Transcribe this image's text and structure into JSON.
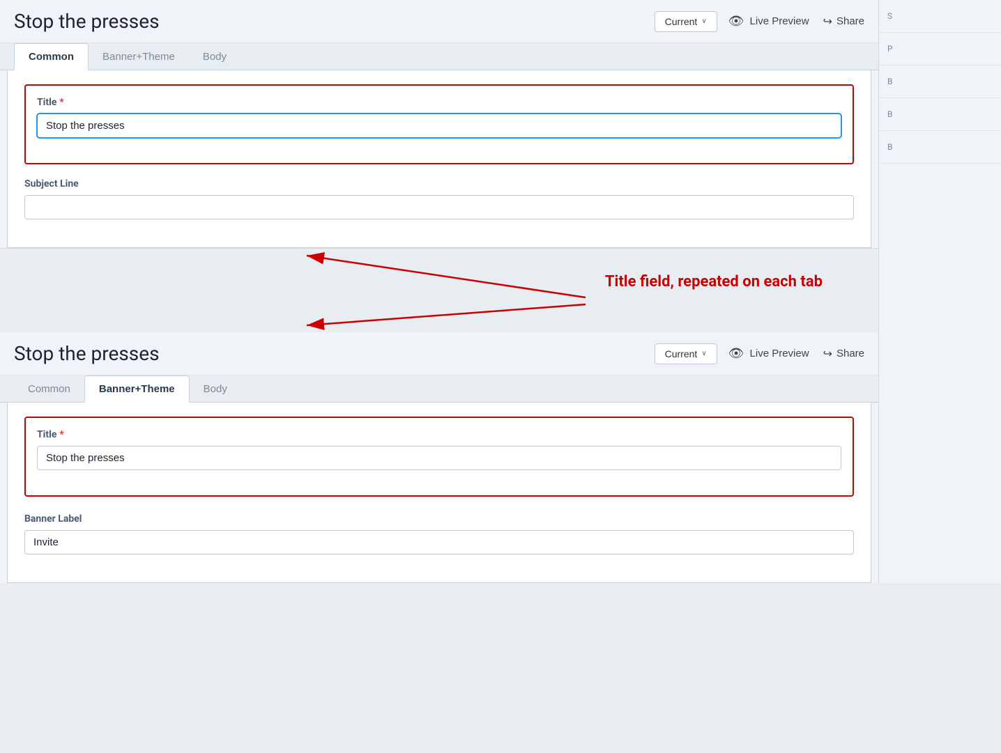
{
  "topSection": {
    "title": "Stop the presses",
    "currentBtn": "Current",
    "chevron": "∨",
    "livePreview": "Live Preview",
    "share": "Share",
    "tabs": [
      {
        "label": "Common",
        "active": true
      },
      {
        "label": "Banner+Theme",
        "active": false
      },
      {
        "label": "Body",
        "active": false
      }
    ],
    "titleField": {
      "label": "Title",
      "required": true,
      "value": "Stop the presses",
      "placeholder": ""
    },
    "subjectLineField": {
      "label": "Subject Line",
      "required": false,
      "value": "",
      "placeholder": ""
    }
  },
  "annotation": {
    "text": "Title field, repeated on each tab"
  },
  "bottomSection": {
    "title": "Stop the presses",
    "currentBtn": "Current",
    "chevron": "∨",
    "livePreview": "Live Preview",
    "share": "Share",
    "tabs": [
      {
        "label": "Common",
        "active": false
      },
      {
        "label": "Banner+Theme",
        "active": true
      },
      {
        "label": "Body",
        "active": false
      }
    ],
    "titleField": {
      "label": "Title",
      "required": true,
      "value": "Stop the presses",
      "placeholder": ""
    },
    "bannerLabelField": {
      "label": "Banner Label",
      "required": false,
      "value": "Invite",
      "placeholder": ""
    }
  },
  "icons": {
    "eye": "👁",
    "share": "↪",
    "chevronDown": "∨"
  },
  "sidebar": {
    "items": [
      "S",
      "P",
      "B",
      "B",
      "B"
    ]
  }
}
